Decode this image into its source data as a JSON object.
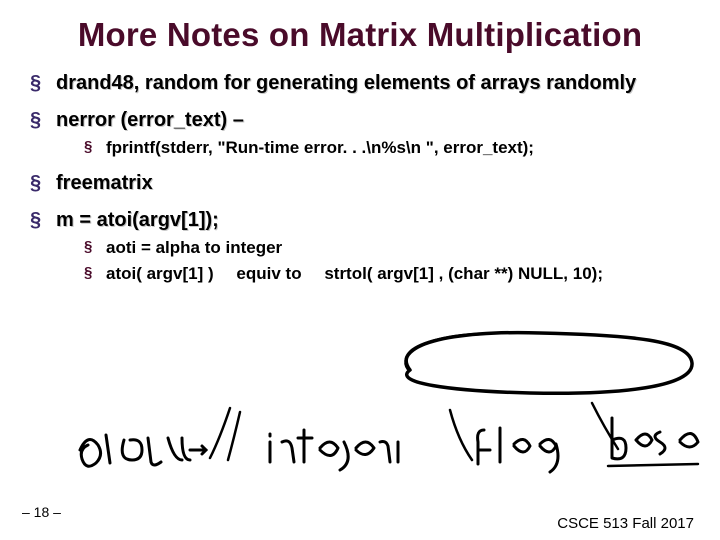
{
  "title": "More Notes on Matrix Multiplication",
  "bullets": {
    "b1": "drand48, random for generating elements of arrays randomly",
    "b2": "nerror (error_text) –",
    "b2_sub1": "fprintf(stderr, \"Run-time error. . .\\n%s\\n \", error_text);",
    "b3": "freematrix",
    "b4": "m = atoi(argv[1]);",
    "b4_sub1": "aoti = alpha to integer",
    "b4_sub2a": "atoi( argv[1] )",
    "b4_sub2_equiv": "equiv to",
    "b4_sub2b": "strtol( argv[1] , (char **) NULL, 10);"
  },
  "footer": {
    "left": "– 18 –",
    "right": "CSCE 513 Fall 2017"
  },
  "handwriting": {
    "w1": "alpha",
    "w2": "integer",
    "w3": "flag",
    "w4": "base"
  }
}
